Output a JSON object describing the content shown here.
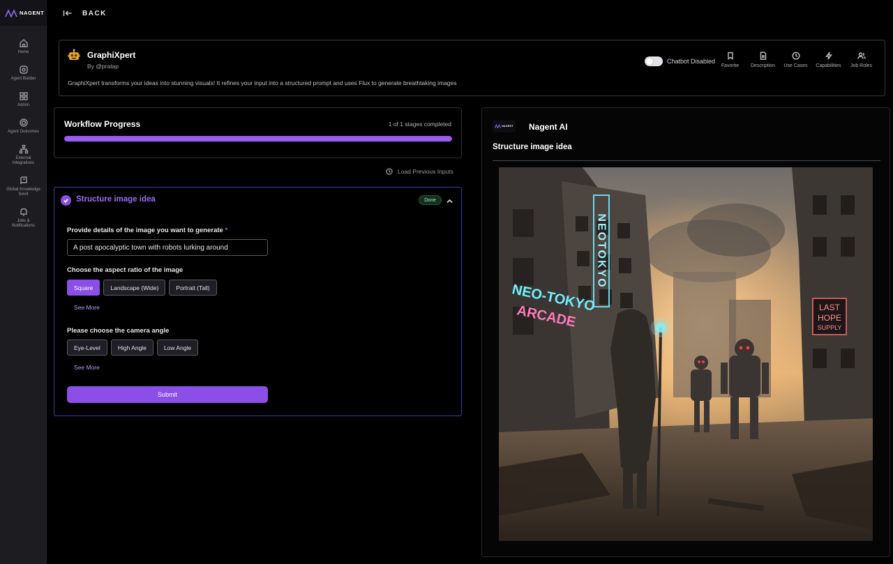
{
  "app": {
    "logo_text": "NAGENT",
    "back_label": "BACK"
  },
  "sidebar": {
    "items": [
      {
        "label": "Home",
        "icon": "home-icon"
      },
      {
        "label": "Agent Builder",
        "icon": "agent-builder-icon"
      },
      {
        "label": "Admin",
        "icon": "admin-icon"
      },
      {
        "label": "Agent Outcomes",
        "icon": "outcomes-icon"
      },
      {
        "label": "External Integrations",
        "icon": "integrations-icon"
      },
      {
        "label": "Global Knowledge Smrit",
        "icon": "knowledge-icon"
      },
      {
        "label": "Jobs & Notifications",
        "icon": "bell-icon"
      }
    ]
  },
  "agent": {
    "name": "GraphiXpert",
    "by": "By @pratap",
    "description": "GraphiXpert transforms your ideas into stunning visuals! It refines your input into a structured prompt and uses Flux to generate breathtaking images",
    "chatbot_label": "Chatbot Disabled",
    "actions": [
      {
        "label": "Favorite",
        "icon": "bookmark-icon"
      },
      {
        "label": "Description",
        "icon": "document-icon"
      },
      {
        "label": "Use Cases",
        "icon": "clock-icon"
      },
      {
        "label": "Capabilities",
        "icon": "lightning-icon"
      },
      {
        "label": "Job Roles",
        "icon": "users-icon"
      }
    ]
  },
  "workflow": {
    "title": "Workflow Progress",
    "count_text": "1 of 1 stages completed",
    "progress_fraction": 1.0,
    "load_previous_label": "Load Previous Inputs"
  },
  "stage": {
    "title": "Structure image idea",
    "badge": "Done",
    "q1_label": "Provide details of the image you want to generate",
    "required_mark": "*",
    "q1_value": "A post apocalyptic town with robots lurking around",
    "q2_label": "Choose the aspect ratio of the image",
    "aspect_options": [
      "Square",
      "Landscape (Wide)",
      "Portrait (Tall)"
    ],
    "aspect_selected": "Square",
    "q3_label": "Please choose the camera angle",
    "angle_options": [
      "Eye-Level",
      "High Angle",
      "Low Angle"
    ],
    "see_more": "See More",
    "submit_label": "Submit"
  },
  "result_panel": {
    "logo_text": "NAGENT",
    "bot_name": "Nagent AI",
    "title": "Structure image idea",
    "image_signs": [
      "NEOTOKYO",
      "NEO-TOKYO",
      "ARCADE",
      "LAST",
      "HOPE",
      "SUPPLY"
    ]
  },
  "colors": {
    "accent": "#8b4fe8",
    "accent_text": "#9d6cf5",
    "badge_bg": "#13301f",
    "stage_border": "#3b3bb0"
  }
}
